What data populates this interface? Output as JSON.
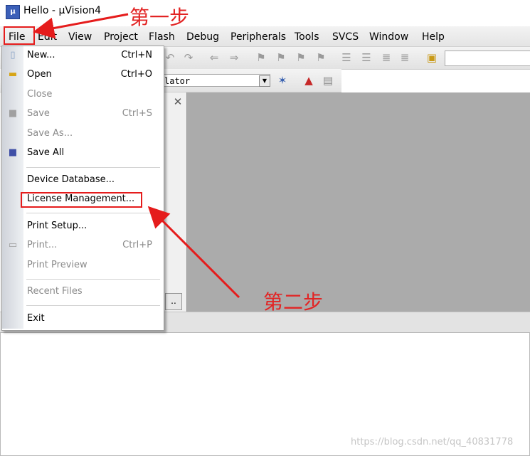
{
  "window": {
    "title": "Hello  - µVision4",
    "icon": "uvision-app-icon"
  },
  "menubar": {
    "items": [
      {
        "label": "File"
      },
      {
        "label": "Edit"
      },
      {
        "label": "View"
      },
      {
        "label": "Project"
      },
      {
        "label": "Flash"
      },
      {
        "label": "Debug"
      },
      {
        "label": "Peripherals"
      },
      {
        "label": "Tools"
      },
      {
        "label": "SVCS"
      },
      {
        "label": "Window"
      },
      {
        "label": "Help"
      }
    ]
  },
  "toolbar": {
    "target_text": "lator"
  },
  "file_menu": {
    "items": [
      {
        "label": "New...",
        "shortcut": "Ctrl+N",
        "enabled": true,
        "icon": "new-file-icon"
      },
      {
        "label": "Open",
        "shortcut": "Ctrl+O",
        "enabled": true,
        "icon": "open-folder-icon"
      },
      {
        "label": "Close",
        "shortcut": "",
        "enabled": false
      },
      {
        "label": "Save",
        "shortcut": "Ctrl+S",
        "enabled": false,
        "icon": "save-icon"
      },
      {
        "label": "Save As...",
        "shortcut": "",
        "enabled": false
      },
      {
        "label": "Save All",
        "shortcut": "",
        "enabled": true,
        "icon": "save-all-icon"
      },
      {
        "label": "Device Database...",
        "shortcut": "",
        "enabled": true
      },
      {
        "label": "License Management...",
        "shortcut": "",
        "enabled": true
      },
      {
        "label": "Print Setup...",
        "shortcut": "",
        "enabled": true
      },
      {
        "label": "Print...",
        "shortcut": "Ctrl+P",
        "enabled": false,
        "icon": "print-icon"
      },
      {
        "label": "Print Preview",
        "shortcut": "",
        "enabled": false
      },
      {
        "label": "Recent Files",
        "shortcut": "",
        "enabled": false
      },
      {
        "label": "Exit",
        "shortcut": "",
        "enabled": true
      }
    ]
  },
  "panes": {
    "tab_overflow": ".."
  },
  "annotations": {
    "step1": "第一步",
    "step2": "第二步",
    "color": "#e51c1c"
  },
  "watermark": "https://blog.csdn.net/qq_40831778"
}
